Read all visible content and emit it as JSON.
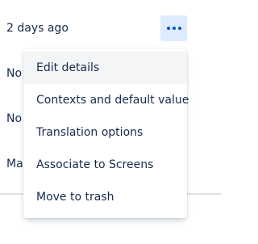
{
  "row": {
    "updated": "2 days ago",
    "more_actions_icon": "more-horizontal-icon"
  },
  "background_rows": [
    {
      "partial_text": "No"
    },
    {
      "partial_text": "No"
    },
    {
      "partial_text": "May"
    }
  ],
  "menu": {
    "items": [
      {
        "label": "Edit details"
      },
      {
        "label": "Contexts and default value"
      },
      {
        "label": "Translation options"
      },
      {
        "label": "Associate to Screens"
      },
      {
        "label": "Move to trash"
      }
    ]
  },
  "colors": {
    "accent": "#0052cc",
    "button_bg": "#deebff",
    "hover_bg": "#f4f5f7",
    "text": "#172b4d",
    "divider": "#dfe1e6"
  }
}
